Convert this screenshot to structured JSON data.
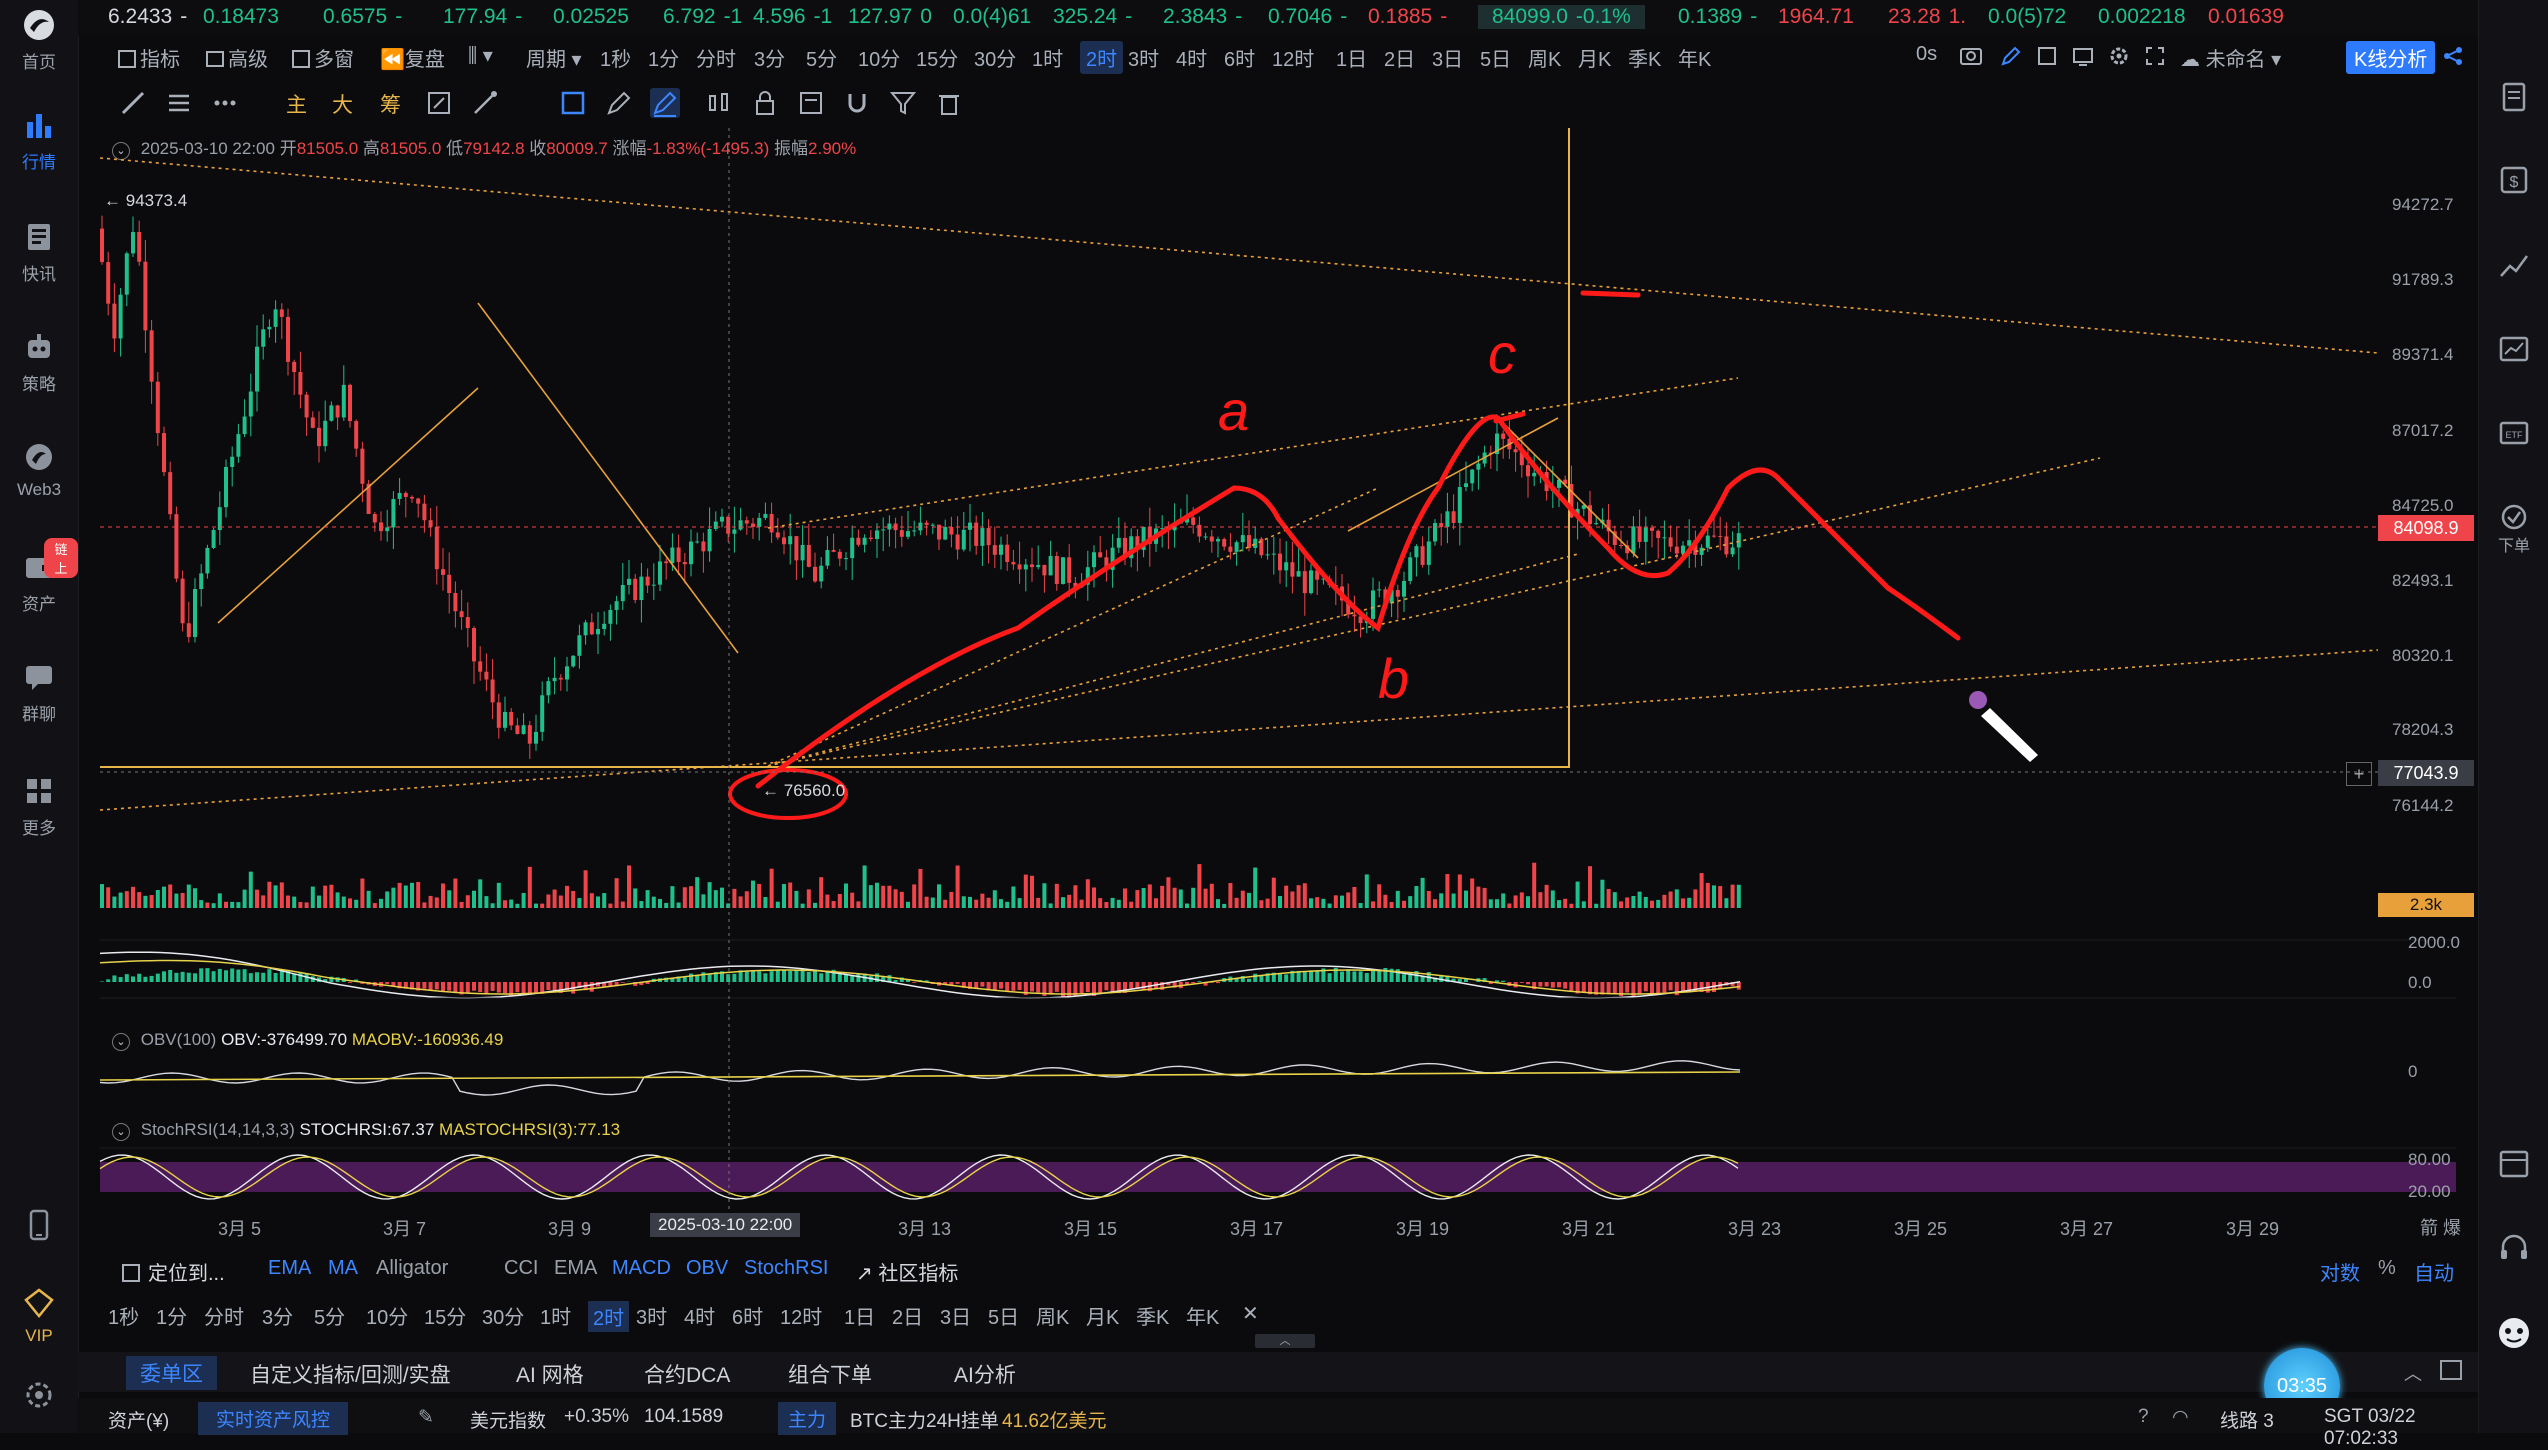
{
  "sidebar_left": {
    "items": [
      {
        "label": "首页",
        "icon": "logo-icon"
      },
      {
        "label": "行情",
        "icon": "chart-bars-icon"
      },
      {
        "label": "快讯",
        "icon": "news-icon"
      },
      {
        "label": "策略",
        "icon": "robot-icon"
      },
      {
        "label": "Web3",
        "icon": "web3-icon"
      },
      {
        "label": "资产",
        "icon": "wallet-icon",
        "badge": "链上"
      },
      {
        "label": "群聊",
        "icon": "chat-icon"
      },
      {
        "label": "更多",
        "icon": "grid-icon"
      },
      {
        "label": "",
        "icon": "phone-icon"
      },
      {
        "label": "VIP",
        "icon": "vip-icon"
      },
      {
        "label": "",
        "icon": "settings-icon"
      }
    ]
  },
  "ticker": [
    {
      "value": "6.2433",
      "change": "-",
      "dir": "wh"
    },
    {
      "value": "0.18473",
      "change": "",
      "dir": "up"
    },
    {
      "value": "0.6575",
      "change": "-",
      "dir": "up"
    },
    {
      "value": "177.94",
      "change": "-",
      "dir": "up"
    },
    {
      "value": "0.02525",
      "change": "",
      "dir": "up"
    },
    {
      "value": "6.792",
      "change": "-1",
      "dir": "up"
    },
    {
      "value": "4.596",
      "change": "-1",
      "dir": "up"
    },
    {
      "value": "127.97",
      "change": "0",
      "dir": "up"
    },
    {
      "value": "0.0(4)61",
      "change": "",
      "dir": "up"
    },
    {
      "value": "325.24",
      "change": "-",
      "dir": "up"
    },
    {
      "value": "2.3843",
      "change": "-",
      "dir": "up"
    },
    {
      "value": "0.7046",
      "change": "-",
      "dir": "up"
    },
    {
      "value": "0.1885",
      "change": "-",
      "dir": "dn"
    },
    {
      "value": "84099.0",
      "change": "-0.1%",
      "dir": "up"
    },
    {
      "value": "0.1389",
      "change": "-",
      "dir": "up"
    },
    {
      "value": "1964.71",
      "change": "",
      "dir": "dn"
    },
    {
      "value": "23.28",
      "change": "1.",
      "dir": "dn"
    },
    {
      "value": "0.0(5)72",
      "change": "",
      "dir": "up"
    },
    {
      "value": "0.002218",
      "change": "",
      "dir": "up"
    },
    {
      "value": "0.01639",
      "change": "",
      "dir": "dn"
    }
  ],
  "toolbar_top": {
    "indicator": "指标",
    "advanced": "高级",
    "multiwindow": "多窗",
    "replay": "复盘",
    "period": "周期",
    "periods": [
      "1秒",
      "1分",
      "分时",
      "3分",
      "5分",
      "10分",
      "15分",
      "30分",
      "1时",
      "2时",
      "3时",
      "4时",
      "6时",
      "12时",
      "1日",
      "2日",
      "3日",
      "5日",
      "周K",
      "月K",
      "季K",
      "年K"
    ],
    "selected_period": "2时",
    "timer": "0s",
    "layout_name": "未命名",
    "kline_analysis": "K线分析"
  },
  "draw_toolbar": {
    "labels": [
      "主",
      "大",
      "筹"
    ]
  },
  "chart_header": {
    "date": "2025-03-10 22:00",
    "open_label": "开",
    "open": "81505.0",
    "high_label": "高",
    "high": "81505.0",
    "low_label": "低",
    "low": "79142.8",
    "close_label": "收",
    "close": "80009.7",
    "change_label": "涨幅",
    "change": "-1.83%(-1495.3)",
    "amp_label": "振幅",
    "amp": "2.90%"
  },
  "price_axis": [
    "94272.7",
    "91789.3",
    "89371.4",
    "87017.2",
    "84725.0",
    "82493.1",
    "80320.1",
    "78204.3",
    "76144.2"
  ],
  "current_price": "84098.9",
  "crosshair_price": "77043.9",
  "high_marker": "94373.4",
  "low_marker": "76560.0",
  "volume_label": "2.3k",
  "macd_axis": [
    "2000.0",
    "0.0"
  ],
  "obv": {
    "title": "OBV(100)",
    "value": "OBV:-376499.70",
    "ma": "MAOBV:-160936.49",
    "axis": "0"
  },
  "stochrsi": {
    "title": "StochRSI(14,14,3,3)",
    "value": "STOCHRSI:67.37",
    "ma": "MASTOCHRSI(3):77.13",
    "axis": [
      "80.00",
      "20.00"
    ]
  },
  "date_axis": [
    "3月 5",
    "3月 7",
    "3月 9",
    "3月 13",
    "3月 15",
    "3月 17",
    "3月 19",
    "3月 21",
    "3月 23",
    "3月 25",
    "3月 27",
    "3月 29"
  ],
  "crosshair_date": "2025-03-10 22:00",
  "annotations": {
    "a": "a",
    "b": "b",
    "c": "c"
  },
  "indicator_bar": {
    "locate": "定位到...",
    "main": [
      "EMA",
      "MA",
      "Alligator"
    ],
    "sub": [
      "CCI",
      "EMA",
      "MACD",
      "OBV",
      "StochRSI"
    ],
    "community": "社区指标",
    "log": "对数",
    "pct": "%",
    "auto": "自动"
  },
  "period_bar_bottom": [
    "1秒",
    "1分",
    "分时",
    "3分",
    "5分",
    "10分",
    "15分",
    "30分",
    "1时",
    "2时",
    "3时",
    "4时",
    "6时",
    "12时",
    "1日",
    "2日",
    "3日",
    "5日",
    "周K",
    "月K",
    "季K",
    "年K"
  ],
  "order_tabs": [
    "委单区",
    "自定义指标/回测/实盘",
    "AI 网格",
    "合约DCA",
    "组合下单",
    "AI分析"
  ],
  "timer_badge": "03:35",
  "status_bar": {
    "assets": "资产(¥)",
    "risk": "实时资产风控",
    "usd_index_label": "美元指数",
    "usd_index_change": "+0.35%",
    "usd_index_value": "104.1589",
    "main_force": "主力",
    "btc_text": "BTC主力24H挂单",
    "btc_value": "41.62亿美元",
    "line": "线路 3",
    "time": "SGT 03/22 07:02:33"
  },
  "right_sidebar": {
    "order_label": "下单"
  },
  "colors": {
    "up": "#1fc08b",
    "down": "#ef454a",
    "accent": "#2f7bff",
    "annotation": "#ff1a1a",
    "fib": "#e8a13a"
  }
}
